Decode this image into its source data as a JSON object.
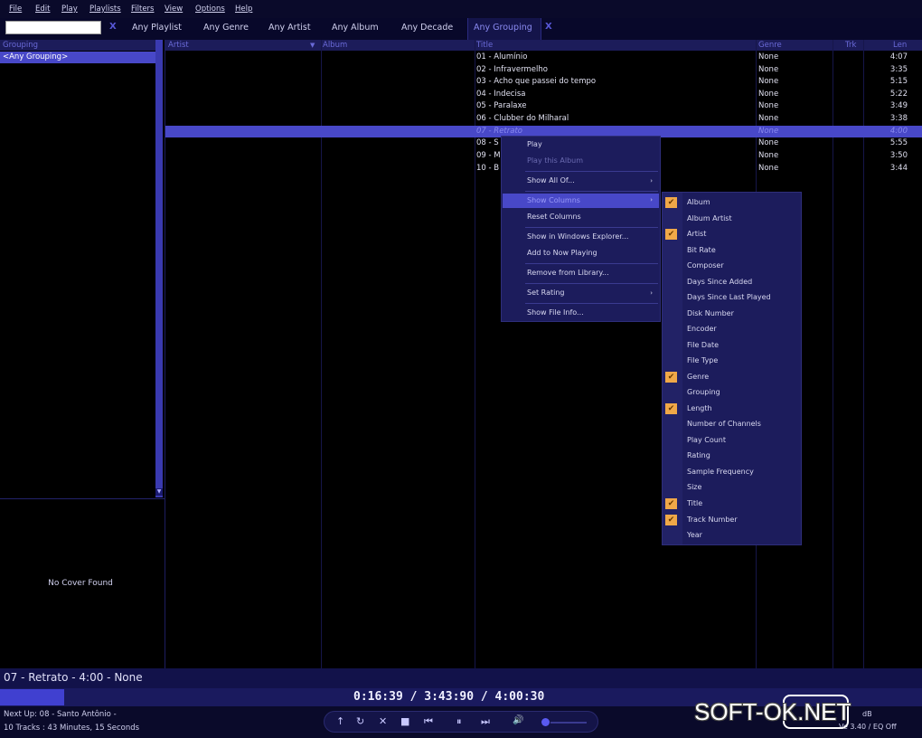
{
  "menu": [
    "File",
    "Edit",
    "Play",
    "Playlists",
    "Filters",
    "View",
    "Options",
    "Help"
  ],
  "filters": {
    "search_value": "",
    "clear": "X",
    "tabs": [
      "Any Playlist",
      "Any Genre",
      "Any Artist",
      "Any Album",
      "Any Decade",
      "Any Grouping"
    ],
    "close": "X"
  },
  "left": {
    "header": "Grouping",
    "selected": "<Any Grouping>",
    "cover": "No Cover Found"
  },
  "columns": [
    "Artist",
    "Album",
    "Title",
    "Genre",
    "Trk",
    "Len"
  ],
  "tracks": [
    {
      "title": "01 - Alumínio",
      "genre": "None",
      "len": "4:07"
    },
    {
      "title": "02 - Infravermelho",
      "genre": "None",
      "len": "3:35"
    },
    {
      "title": "03 - Acho que passei do tempo",
      "genre": "None",
      "len": "5:15"
    },
    {
      "title": "04 - Indecisa",
      "genre": "None",
      "len": "5:22"
    },
    {
      "title": "05 - Paralaxe",
      "genre": "None",
      "len": "3:49"
    },
    {
      "title": "06 - Clubber do Milharal",
      "genre": "None",
      "len": "3:38"
    },
    {
      "title": "07 - Retrato",
      "genre": "None",
      "len": "4:00"
    },
    {
      "title": "08 - S",
      "genre": "None",
      "len": "5:55"
    },
    {
      "title": "09 - M",
      "genre": "None",
      "len": "3:50"
    },
    {
      "title": "10 - B",
      "genre": "None",
      "len": "3:44"
    }
  ],
  "context_menu": {
    "items": [
      "Play",
      "Play this Album",
      "Show All Of...",
      "Show Columns",
      "Reset Columns",
      "Show in Windows Explorer...",
      "Add to Now Playing",
      "Remove from Library...",
      "Set Rating",
      "Show File Info..."
    ],
    "submenu_arrow": "›"
  },
  "columns_submenu": {
    "items": [
      "Album",
      "Album Artist",
      "Artist",
      "Bit Rate",
      "Composer",
      "Days Since Added",
      "Days Since Last Played",
      "Disk Number",
      "Encoder",
      "File Date",
      "File Type",
      "Genre",
      "Grouping",
      "Length",
      "Number of Channels",
      "Play Count",
      "Rating",
      "Sample Frequency",
      "Size",
      "Title",
      "Track Number",
      "Year"
    ],
    "checked": [
      "Album",
      "Artist",
      "Genre",
      "Length",
      "Title",
      "Track Number"
    ],
    "check_glyph": "✔"
  },
  "now_playing": "07 - Retrato - 4:00 - None",
  "progress_fraction": 0.0698,
  "time": "0:16:39  /  3:43:90  /  4:00:30",
  "next_up": "Next Up: 08 - Santo Antônio -",
  "tracks_summary": "10 Tracks : 43 Minutes, 15 Seconds",
  "right_status": "dB",
  "right_status2": "Ve  3.40 / EQ Off",
  "watermark": {
    "left": "SOFT-",
    "box": "OK",
    "right": ".NET"
  },
  "transport_icons": [
    "↑",
    "↻",
    "✕",
    "■",
    "⏮",
    "⏸",
    "⏭",
    "🔊"
  ]
}
